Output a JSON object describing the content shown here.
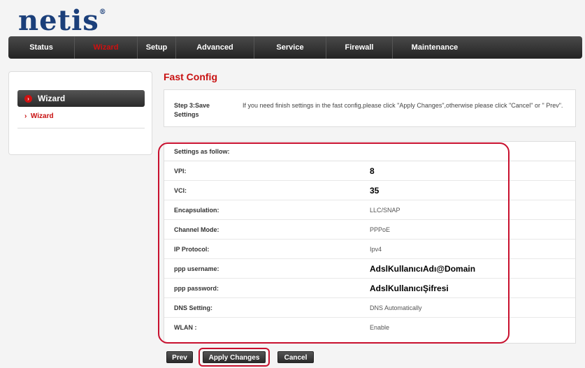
{
  "brand": {
    "logo": "netis",
    "mark": "®"
  },
  "nav": {
    "items": [
      {
        "label": "Status"
      },
      {
        "label": "Wizard",
        "active": true
      },
      {
        "label": "Setup"
      },
      {
        "label": "Advanced"
      },
      {
        "label": "Service"
      },
      {
        "label": "Firewall"
      },
      {
        "label": "Maintenance"
      }
    ]
  },
  "sidebar": {
    "heading": "Wizard",
    "link": "Wizard"
  },
  "page": {
    "title": "Fast Config"
  },
  "step": {
    "label": "Step 3:Save Settings",
    "text": "If you need finish settings in the fast config,please click \"Apply Changes\",otherwise please click \"Cancel\" or \" Prev\"."
  },
  "settings": {
    "header": "Settings as follow:",
    "rows": [
      {
        "label": "VPI:",
        "value": "8"
      },
      {
        "label": "VCI:",
        "value": "35"
      },
      {
        "label": "Encapsulation:",
        "value": "LLC/SNAP"
      },
      {
        "label": "Channel Mode:",
        "value": "PPPoE"
      },
      {
        "label": "IP Protocol:",
        "value": "Ipv4"
      },
      {
        "label": "ppp username:",
        "value": "AdslKullanıcıAdı@Domain"
      },
      {
        "label": "ppp password:",
        "value": "AdslKullanıcıŞifresi"
      },
      {
        "label": "DNS Setting:",
        "value": "DNS Automatically"
      },
      {
        "label": "WLAN :",
        "value": "Enable"
      }
    ]
  },
  "buttons": {
    "prev": "Prev",
    "apply": "Apply Changes",
    "cancel": "Cancel"
  },
  "colors": {
    "accent": "#c81010",
    "outline": "#c8102e",
    "brand": "#1b3f7a"
  }
}
